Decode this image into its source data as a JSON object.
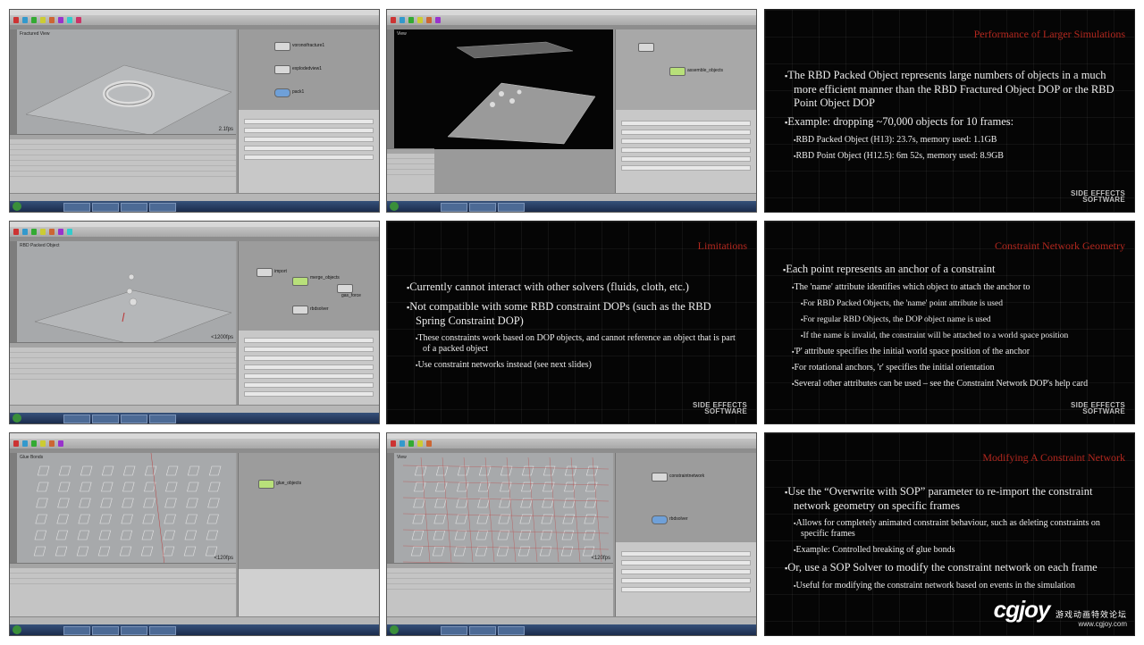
{
  "slides": {
    "performance": {
      "title": "Performance of Larger Simulations",
      "bullets": [
        {
          "level": 1,
          "text": "The RBD Packed Object represents large numbers of objects in a much more efficient manner than the RBD Fractured Object DOP or the RBD Point Object DOP"
        },
        {
          "level": 1,
          "text": "Example: dropping ~70,000 objects for 10 frames:"
        },
        {
          "level": 2,
          "text": "RBD Packed Object (H13): 23.7s, memory used: 1.1GB"
        },
        {
          "level": 2,
          "text": "RBD Point Object (H12.5): 6m 52s, memory used: 8.9GB"
        }
      ]
    },
    "limitations": {
      "title": "Limitations",
      "bullets": [
        {
          "level": 1,
          "text": "Currently cannot interact with other solvers (fluids, cloth, etc.)"
        },
        {
          "level": 1,
          "text": "Not compatible with some RBD constraint DOPs (such as the RBD Spring Constraint DOP)"
        },
        {
          "level": 2,
          "text": "These constraints work based on DOP objects, and cannot reference an object that is part of a packed object"
        },
        {
          "level": 2,
          "text": "Use constraint networks instead (see next slides)"
        }
      ]
    },
    "constraint_geometry": {
      "title": "Constraint Network Geometry",
      "bullets": [
        {
          "level": 1,
          "text": "Each point represents an anchor of a constraint"
        },
        {
          "level": 2,
          "text": "The 'name' attribute identifies which object to attach the anchor to"
        },
        {
          "level": 3,
          "text": "For RBD Packed Objects, the 'name' point attribute is used"
        },
        {
          "level": 3,
          "text": "For regular RBD Objects, the DOP object name is used"
        },
        {
          "level": 3,
          "text": "If the name is invalid, the constraint will be attached to a world space position"
        },
        {
          "level": 2,
          "text": "'P' attribute specifies the initial world space position of the anchor"
        },
        {
          "level": 2,
          "text": "For rotational anchors, 'r' specifies the initial orientation"
        },
        {
          "level": 2,
          "text": "Several other attributes can be used – see the Constraint Network DOP's help card"
        }
      ]
    },
    "modifying": {
      "title": "Modifying A Constraint Network",
      "bullets": [
        {
          "level": 1,
          "text": "Use the “Overwrite with SOP” parameter to re-import the constraint network geometry on specific frames"
        },
        {
          "level": 2,
          "text": "Allows for completely animated constraint behaviour, such as deleting constraints on specific frames"
        },
        {
          "level": 2,
          "text": "Example: Controlled breaking of glue bonds"
        },
        {
          "level": 1,
          "text": "Or, use a SOP Solver to modify the constraint network on each frame"
        },
        {
          "level": 2,
          "text": "Useful for modifying the constraint network based on events in the simulation"
        }
      ]
    },
    "brand_line1": "SIDE EFFECTS",
    "brand_line2": "SOFTWARE"
  },
  "screens": {
    "s1": {
      "view_label": "Fractured View",
      "fps": "2.1fps",
      "nodes": [
        "voronoifracture1",
        "explodedview1",
        "pack1"
      ]
    },
    "s2": {
      "view_label": "View",
      "nodes": [
        "",
        "assemble_objects"
      ]
    },
    "s3": {
      "view_label": "RBD Packed Object",
      "fps": "<1200fps",
      "nodes": [
        "import",
        "merge_objects",
        "gas_force",
        "rbdsolver"
      ]
    },
    "s4": {
      "view_label": "Glue Bonds",
      "fps": "<120fps",
      "nodes": [
        "glue_objects"
      ]
    },
    "s5": {
      "view_label": "View",
      "fps": "<120fps",
      "nodes": [
        "constraintnetwork",
        "rbdsolver"
      ]
    }
  },
  "watermark": {
    "logo": "cgjoy",
    "cn": "游戏动画特效论坛",
    "url": "www.cgjoy.com"
  },
  "colors": {
    "slide_bg": "#050505",
    "slide_title": "#b3271e",
    "slide_text": "#ececec",
    "ui_gray": "#9a9a9a",
    "taskbar": "#1b2c4d"
  }
}
